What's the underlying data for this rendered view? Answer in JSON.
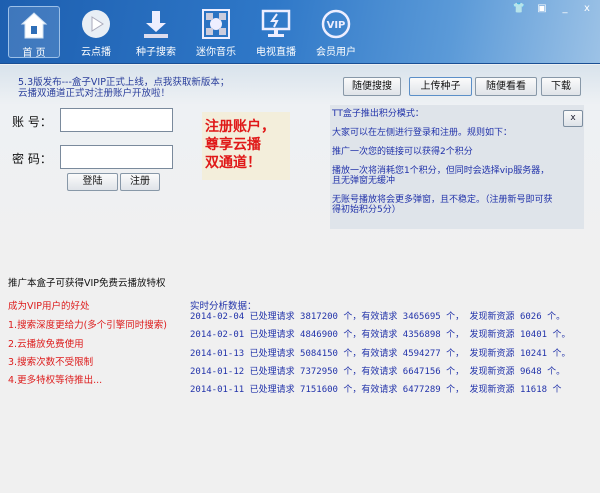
{
  "nav": [
    {
      "label": "首 页",
      "icon": "home-icon"
    },
    {
      "label": "云点播",
      "icon": "play-icon"
    },
    {
      "label": "种子搜索",
      "icon": "download-icon"
    },
    {
      "label": "迷你音乐",
      "icon": "music-icon"
    },
    {
      "label": "电视直播",
      "icon": "tv-icon"
    },
    {
      "label": "会员用户",
      "icon": "vip-icon"
    }
  ],
  "window_controls": {
    "skin": "👕",
    "mini": "▣",
    "minimize": "_",
    "close": "x"
  },
  "notice": [
    "5.3版发布---盒子VIP正式上线，点我获取新版本；",
    "云播双通道正式对注册账户开放啦！"
  ],
  "toolbar": [
    "随便搜搜",
    "上传种子",
    "随便看看",
    "下载"
  ],
  "login": {
    "account_label": "账 号：",
    "password_label": "密 码：",
    "account_value": "",
    "password_value": "",
    "login_btn": "登陆",
    "register_btn": "注册"
  },
  "promo": [
    "注册账户，",
    "尊享云播",
    "双通道！"
  ],
  "panel": {
    "close": "x",
    "lines": [
      "TT盒子推出积分模式：",
      "大家可以在左侧进行登录和注册。规则如下：",
      "推广一次您的链接可以获得2个积分",
      "播放一次将消耗您1个积分，但同时会选择vip服务器，且无弹窗无缓冲",
      "无账号播放将会更多弹窗，且不稳定。（注册新号即可获得初始积分5分）"
    ]
  },
  "promo_heading": "推广本盒子可获得VIP免费云播放特权",
  "vip_benefits": [
    "成为VIP用户的好处",
    "1.搜索深度更给力(多个引擎同时搜索)",
    "2.云播放免费使用",
    "3.搜索次数不受限制",
    "4.更多特权等待推出..."
  ],
  "stats": {
    "title": "实时分析数据：",
    "rows": [
      "2014-02-04 已处理请求 3817200 个，有效请求 3465695 个， 发现新资源 6026 个。",
      "2014-02-01 已处理请求 4846900 个，有效请求 4356898 个， 发现新资源 10401 个。",
      "2014-01-13 已处理请求 5084150 个，有效请求 4594277 个， 发现新资源 10241 个。",
      "2014-01-12 已处理请求 7372950 个，有效请求 6647156 个， 发现新资源 9648 个。",
      "2014-01-11 已处理请求 7151600 个，有效请求 6477289 个， 发现新资源 11618 个"
    ]
  }
}
